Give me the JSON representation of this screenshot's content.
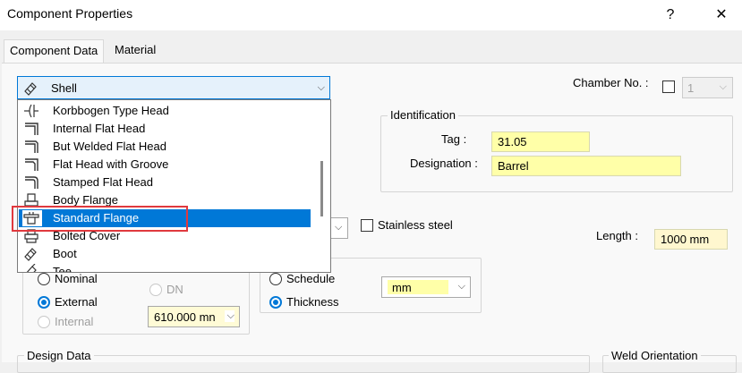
{
  "window": {
    "title": "Component Properties",
    "help_glyph": "?",
    "close_glyph": "✕"
  },
  "tabs": [
    {
      "label": "Component Data"
    },
    {
      "label": "Material"
    }
  ],
  "component_combo": {
    "value": "Shell",
    "icon": "shell-icon",
    "arrow_glyph": "⌵"
  },
  "dropdown": {
    "items": [
      {
        "label": "Korbbogen Type Head",
        "icon": "korbbogen-head-icon"
      },
      {
        "label": "Internal Flat Head",
        "icon": "internal-flat-head-icon"
      },
      {
        "label": "But Welded Flat Head",
        "icon": "butt-welded-flat-head-icon"
      },
      {
        "label": "Flat Head with Groove",
        "icon": "flat-head-groove-icon"
      },
      {
        "label": "Stamped Flat Head",
        "icon": "stamped-flat-head-icon"
      },
      {
        "label": "Body Flange",
        "icon": "body-flange-icon"
      },
      {
        "label": "Standard Flange",
        "icon": "standard-flange-icon",
        "selected": true
      },
      {
        "label": "Bolted Cover",
        "icon": "bolted-cover-icon"
      },
      {
        "label": "Boot",
        "icon": "boot-icon"
      },
      {
        "label": "Tee",
        "icon": "tee-icon"
      }
    ]
  },
  "chamber": {
    "label": "Chamber No. :",
    "value": "1",
    "arrow_glyph": "⌵"
  },
  "identification": {
    "title": "Identification",
    "tag_label": "Tag :",
    "tag_value": "31.05",
    "designation_label": "Designation :",
    "designation_value": "Barrel"
  },
  "material_row": {
    "arrow_glyph": "⌵",
    "stainless_label": "Stainless steel",
    "length_label": "Length :",
    "length_value": "1000 mm"
  },
  "diameter": {
    "nominal_label": "Nominal",
    "dn_label": "DN",
    "external_label": "External",
    "internal_label": "Internal",
    "value": "610.000 mn",
    "arrow_glyph": "⌵"
  },
  "thickness": {
    "schedule_label": "Schedule",
    "thickness_label": "Thickness",
    "unit_value": "mm",
    "arrow_glyph": "⌵"
  },
  "bottom": {
    "design_data_title": "Design Data",
    "weld_orientation_title": "Weld Orientation"
  }
}
